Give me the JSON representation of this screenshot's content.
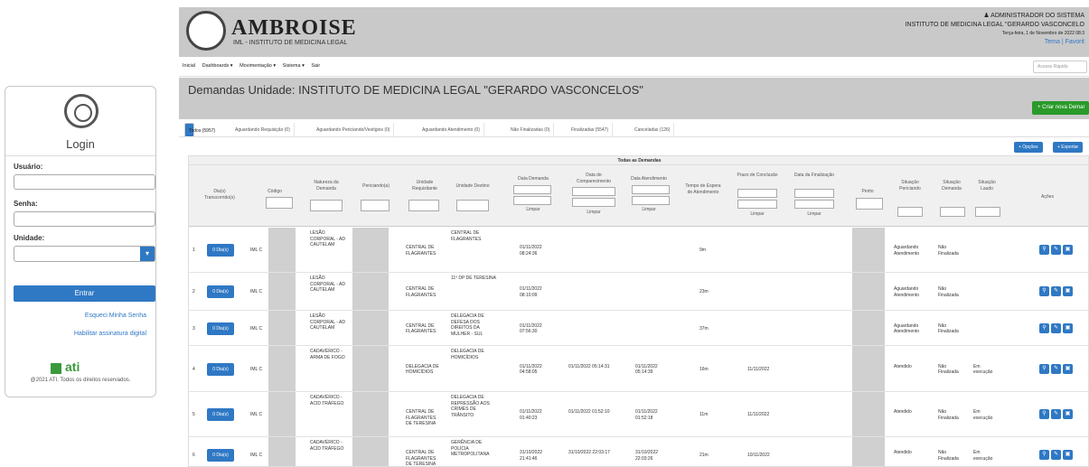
{
  "login": {
    "title": "Login",
    "usuario_label": "Usuário:",
    "senha_label": "Senha:",
    "unidade_label": "Unidade:",
    "entrar_label": "Entrar",
    "forgot_label": "Esqueci Minha Senha",
    "digital_label": "Habilitar assinatura digital",
    "ati_label": "ati",
    "footer": "@2021 ATI. Todos os direitos reservados."
  },
  "header": {
    "brand": "AMBROISE",
    "brand_sub": "IML - INSTITUTO DE MEDICINA LEGAL",
    "user": "ADMINISTRADOR DO SISTEMA",
    "institute": "INSTITUTO DE MEDICINA LEGAL \"GERARDO VASCONCELO",
    "date": "Terça-feira, 1 de Novembro de 2022 08:3",
    "links": "Tema | Favorit"
  },
  "nav": {
    "items": [
      "Inicial",
      "Dashboards ▾",
      "Movimentação ▾",
      "Sistema ▾",
      "Sair"
    ],
    "search_placeholder": "Acesso Rápido"
  },
  "page": {
    "title": "Demandas Unidade: INSTITUTO DE MEDICINA LEGAL \"GERARDO VASCONCELOS\"",
    "new_button": "+ Criar nova Demar"
  },
  "tabs": [
    "Todos (5957)",
    "Aguardando Requisição (0)",
    "Aguardando Periciando/Vestígios (0)",
    "Aguardando Atendimento (0)",
    "Não Finalizadas (0)",
    "Finalizadas (5547)",
    "Canceladas (126)"
  ],
  "toolbar": {
    "options": "+ Opções",
    "export": "+ Exportar"
  },
  "grid": {
    "title": "Todas as Demandas",
    "headers": [
      "Dia(s) Transcorrido(s)",
      "Código",
      "Natureza da Demanda",
      "Periciando(a)",
      "Unidade Requisitante",
      "Unidade Destino",
      "Data Demanda",
      "Data de Comparecimento",
      "Data Atendimento",
      "Tempo de Espera de Atendimento",
      "Prazo de Conclusão",
      "Data da Finalização",
      "Perito",
      "Situação Periciando",
      "Situação Demanda",
      "Situação Laudo",
      "Ações"
    ],
    "filter": {
      "de": "de",
      "ate": "até",
      "limpar": "Limpar",
      "zero": "0"
    },
    "rows": [
      {
        "n": "1",
        "dias": "0 Dia(s)",
        "codigo": "IML C",
        "natureza": "LESÃO CORPORAL - AD CAUTELAM",
        "req": "CENTRAL DE FLAGRANTES",
        "dest": "CENTRAL DE FLAGRANTES",
        "data": "01/11/2022 08:24:36",
        "comp": "",
        "atend": "",
        "espera": "9m",
        "prazo": "",
        "final": "",
        "sitp": "Aguardando Atendimento",
        "sitd": "Não Finalizada",
        "sitl": ""
      },
      {
        "n": "2",
        "dias": "0 Dia(s)",
        "codigo": "IML C",
        "natureza": "LESÃO CORPORAL - AD CAUTELAM",
        "req": "CENTRAL DE FLAGRANTES",
        "dest": "11º DP DE TERESINA",
        "data": "01/11/2022 08:10:09",
        "comp": "",
        "atend": "",
        "espera": "23m",
        "prazo": "",
        "final": "",
        "sitp": "Aguardando Atendimento",
        "sitd": "Não Finalizada",
        "sitl": ""
      },
      {
        "n": "3",
        "dias": "0 Dia(s)",
        "codigo": "IML C",
        "natureza": "LESÃO CORPORAL - AD CAUTELAM",
        "req": "CENTRAL DE FLAGRANTES",
        "dest": "DELEGACIA DE DEFESA DOS DIREITOS DA MULHER - SUL",
        "data": "01/11/2022 07:56:30",
        "comp": "",
        "atend": "",
        "espera": "37m",
        "prazo": "",
        "final": "",
        "sitp": "Aguardando Atendimento",
        "sitd": "Não Finalizada",
        "sitl": ""
      },
      {
        "n": "4",
        "dias": "0 Dia(s)",
        "codigo": "IML C",
        "natureza": "CADAVÉRICO - ARMA DE FOGO",
        "req": "DELEGACIA DE HOMICÍDIOS",
        "dest": "DELEGACIA DE HOMICÍDIOS",
        "data": "01/11/2022 04:58:05",
        "comp": "01/11/2022 05:14:31",
        "atend": "01/11/2022 05:14:39",
        "espera": "16m",
        "prazo": "11/11/2022",
        "final": "",
        "sitp": "Atendido",
        "sitd": "Não Finalizada",
        "sitl": "Em execução"
      },
      {
        "n": "5",
        "dias": "0 Dia(s)",
        "codigo": "IML C",
        "natureza": "CADAVÉRICO - ACID TRÁFEGO",
        "req": "CENTRAL DE FLAGRANTES DE TERESINA",
        "dest": "DELEGACIA DE REPRESSÃO AOS CRIMES DE TRÂNSITO",
        "data": "01/11/2022 01:40:23",
        "comp": "01/11/2022 01:52:10",
        "atend": "01/11/2022 01:52:18",
        "espera": "11m",
        "prazo": "11/11/2022",
        "final": "",
        "sitp": "Atendido",
        "sitd": "Não Finalizada",
        "sitl": "Em execução"
      },
      {
        "n": "6",
        "dias": "0 Dia(s)",
        "codigo": "IML C",
        "natureza": "CADAVÉRICO - ACID TRÁFEGO",
        "req": "CENTRAL DE FLAGRANTES DE TERESINA",
        "dest": "GERÊNCIA DE POLÍCIA METROPOLITANA",
        "data": "31/10/2022 21:41:46",
        "comp": "31/10/2022 22:03:17",
        "atend": "31/10/2022 22:03:26",
        "espera": "21m",
        "prazo": "10/11/2022",
        "final": "",
        "sitp": "Atendido",
        "sitd": "Não Finalizada",
        "sitl": "Em execução"
      }
    ]
  },
  "colors": {
    "accent": "#2f78c4",
    "header_gray": "#c9c9c9",
    "success": "#2a9a2a"
  }
}
